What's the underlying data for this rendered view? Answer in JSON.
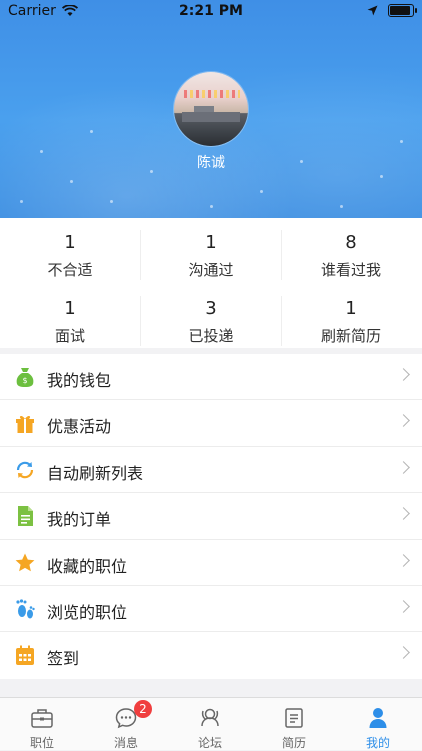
{
  "status_bar": {
    "carrier": "Carrier",
    "time": "2:21 PM"
  },
  "profile": {
    "name": "陈诚"
  },
  "stats": [
    {
      "value": "1",
      "label": "不合适"
    },
    {
      "value": "1",
      "label": "沟通过"
    },
    {
      "value": "8",
      "label": "谁看过我"
    },
    {
      "value": "1",
      "label": "面试"
    },
    {
      "value": "3",
      "label": "已投递"
    },
    {
      "value": "1",
      "label": "刷新简历"
    }
  ],
  "menu": [
    {
      "label": "我的钱包",
      "icon": "money-bag-icon",
      "color": "#6cbf3f"
    },
    {
      "label": "优惠活动",
      "icon": "gift-icon",
      "color": "#f5a623"
    },
    {
      "label": "自动刷新列表",
      "icon": "refresh-icon",
      "color": "#3a9be8"
    },
    {
      "label": "我的订单",
      "icon": "document-icon",
      "color": "#7cc142"
    },
    {
      "label": "收藏的职位",
      "icon": "star-icon",
      "color": "#f5a623"
    },
    {
      "label": "浏览的职位",
      "icon": "footprints-icon",
      "color": "#3a9be8"
    },
    {
      "label": "签到",
      "icon": "calendar-icon",
      "color": "#f5a623"
    }
  ],
  "tabs": [
    {
      "label": "职位",
      "icon": "briefcase-icon"
    },
    {
      "label": "消息",
      "icon": "chat-icon",
      "badge": "2"
    },
    {
      "label": "论坛",
      "icon": "forum-icon"
    },
    {
      "label": "简历",
      "icon": "resume-icon"
    },
    {
      "label": "我的",
      "icon": "person-icon",
      "active": true
    }
  ],
  "colors": {
    "accent": "#2d8ee8",
    "badge": "#f03e3e"
  }
}
